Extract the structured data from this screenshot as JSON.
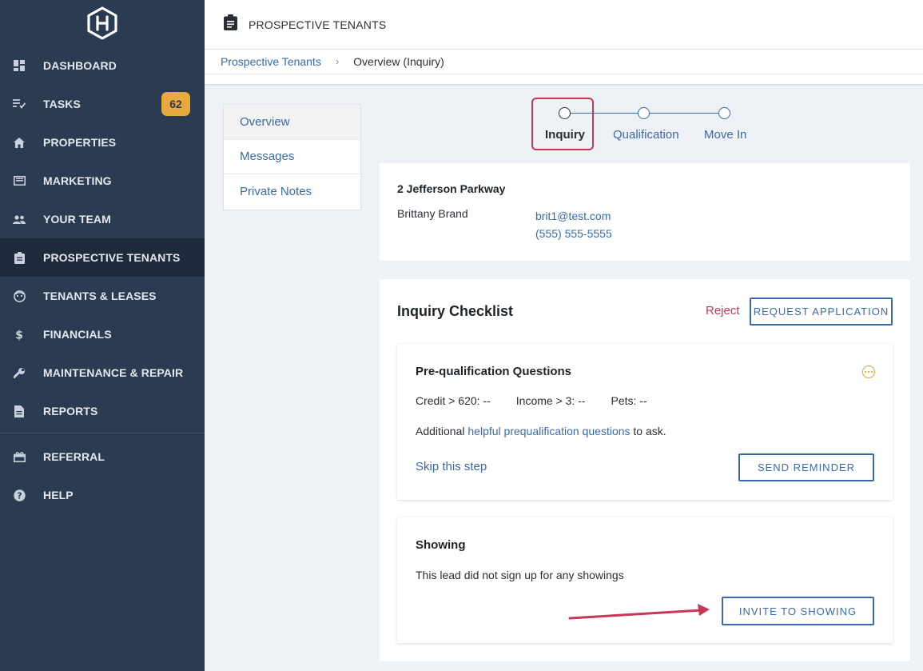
{
  "sidebar": {
    "items": [
      {
        "label": "DASHBOARD",
        "icon": "dashboard-icon"
      },
      {
        "label": "TASKS",
        "icon": "tasks-icon",
        "badge": "62"
      },
      {
        "label": "PROPERTIES",
        "icon": "home-icon"
      },
      {
        "label": "MARKETING",
        "icon": "marketing-icon"
      },
      {
        "label": "YOUR TEAM",
        "icon": "team-icon"
      },
      {
        "label": "PROSPECTIVE TENANTS",
        "icon": "clipboard-icon",
        "active": true
      },
      {
        "label": "TENANTS & LEASES",
        "icon": "tenant-face-icon"
      },
      {
        "label": "FINANCIALS",
        "icon": "dollar-icon"
      },
      {
        "label": "MAINTENANCE & REPAIR",
        "icon": "wrench-icon"
      },
      {
        "label": "REPORTS",
        "icon": "document-icon"
      }
    ],
    "secondary_items": [
      {
        "label": "REFERRAL",
        "icon": "gift-icon"
      },
      {
        "label": "HELP",
        "icon": "help-icon"
      }
    ]
  },
  "header": {
    "title": "PROSPECTIVE TENANTS"
  },
  "breadcrumb": {
    "parent": "Prospective Tenants",
    "separator": "›",
    "current": "Overview (Inquiry)"
  },
  "subnav": {
    "items": [
      "Overview",
      "Messages",
      "Private Notes"
    ]
  },
  "stepper": {
    "steps": [
      {
        "label": "Inquiry",
        "current": true
      },
      {
        "label": "Qualification"
      },
      {
        "label": "Move In"
      }
    ]
  },
  "lead": {
    "property": "2 Jefferson Parkway",
    "name": "Brittany Brand",
    "email": "brit1@test.com",
    "phone": "(555) 555-5555"
  },
  "checklist": {
    "title": "Inquiry Checklist",
    "reject_label": "Reject",
    "request_label": "REQUEST APPLICATION",
    "prequal": {
      "title": "Pre-qualification Questions",
      "credit": "Credit > 620: --",
      "income": "Income > 3: --",
      "pets": "Pets: --",
      "help_prefix": "Additional",
      "help_link": "helpful prequalification questions",
      "help_suffix": "to ask.",
      "skip_label": "Skip this step",
      "reminder_label": "SEND REMINDER"
    },
    "showing": {
      "title": "Showing",
      "description": "This lead did not sign up for any showings",
      "invite_label": "INVITE TO SHOWING"
    }
  },
  "colors": {
    "sidebar_bg": "#2b3b52",
    "sidebar_active": "#1e2b3d",
    "accent_blue": "#3a6aa8",
    "badge": "#e9a93c",
    "highlight_red": "#c8375a"
  }
}
